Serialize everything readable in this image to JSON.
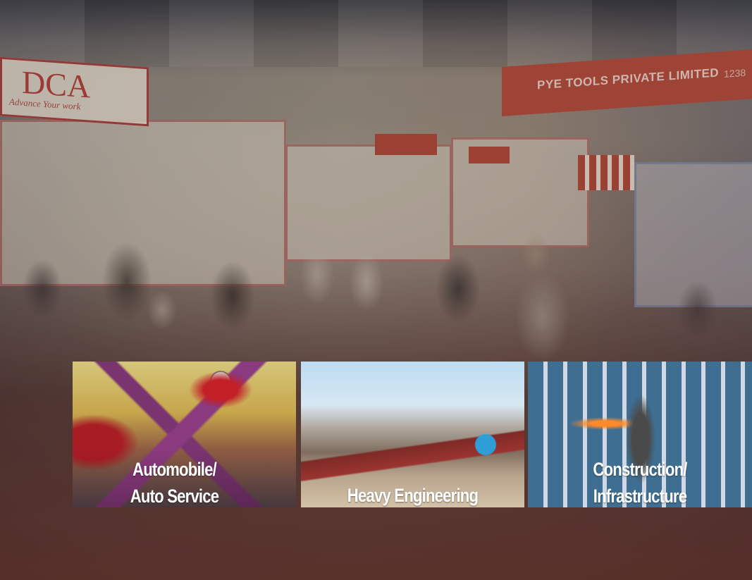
{
  "hero": {
    "signs": {
      "dca_logo": "DCA",
      "dca_tagline": "Advance Your work",
      "pye_tools": "PYE TOOLS PRIVATE LIMITED",
      "pye_number": "1238"
    }
  },
  "categories": [
    {
      "line1": "Automobile/",
      "line2": "Auto Service"
    },
    {
      "line1": "Heavy Engineering",
      "line2": ""
    },
    {
      "line1": "Construction/",
      "line2": "Infrastructure"
    }
  ]
}
